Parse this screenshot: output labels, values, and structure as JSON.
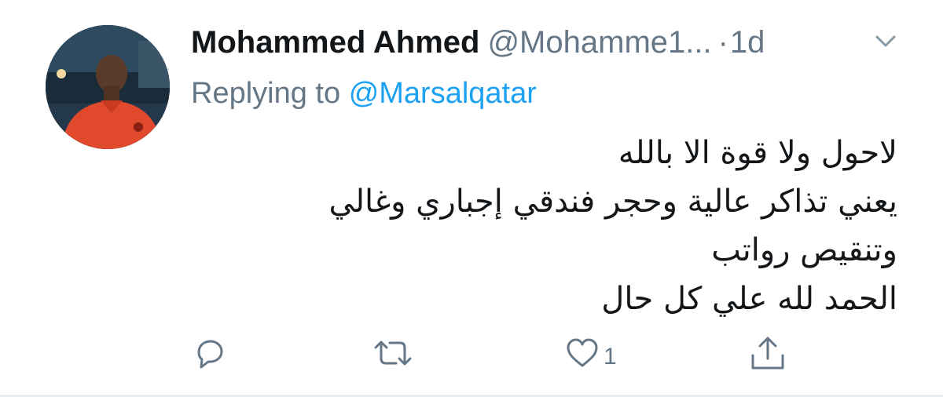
{
  "tweet": {
    "display_name": "Mohammed Ahmed",
    "handle": "@Mohamme1...",
    "dot": "·",
    "time": "1d",
    "replying_prefix": "Replying to",
    "replying_to": "@Marsalqatar",
    "body_lines": [
      "لاحول ولا قوة الا بالله",
      "يعني تذاكر عالية وحجر فندقي إجباري وغالي",
      "وتنقيص رواتب",
      "الحمد لله علي كل حال"
    ],
    "actions": {
      "reply_icon": "reply-icon",
      "retweet_icon": "retweet-icon",
      "like_icon": "heart-icon",
      "like_count": "1",
      "share_icon": "share-icon"
    }
  },
  "colors": {
    "text": "#14171a",
    "secondary": "#657786",
    "link": "#1da1f2",
    "divider": "#e6ecf0"
  }
}
